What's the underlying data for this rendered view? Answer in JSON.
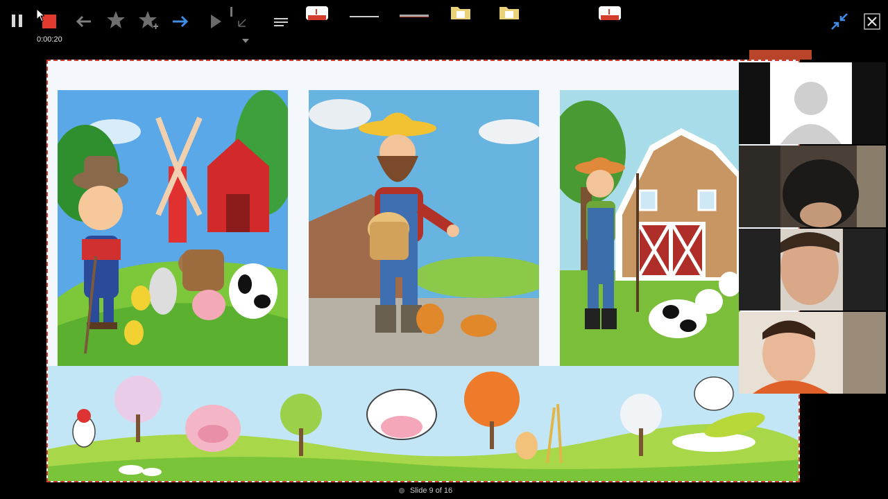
{
  "toolbar": {
    "timer": "0:00:20",
    "icons": [
      "pause-icon",
      "stop-icon",
      "back-arrow-icon",
      "star-icon",
      "star-plus-icon",
      "forward-arrow-icon",
      "play-icon",
      "resize-icon",
      "menu-icon",
      "pdf-doc-icon",
      "line-icon",
      "pen-icon",
      "folder-icon",
      "folder-icon",
      "pdf-doc-icon",
      "collapse-icon",
      "close-icon"
    ]
  },
  "slide": {
    "pictures": [
      "boy-farmer-with-animals",
      "farmer-feeding-chickens",
      "farmer-at-barn-with-cow"
    ],
    "banner": "cartoon-farm-animals-strip"
  },
  "participants": {
    "tiles": [
      "participant-placeholder-avatar",
      "participant-video-1",
      "participant-video-2",
      "participant-video-3"
    ]
  },
  "status": {
    "slide_counter": "Slide 9 of 16"
  },
  "colors": {
    "accent_blue": "#3f8ee6",
    "stop_red": "#e23a2e",
    "slide_border": "#d23a2a"
  }
}
